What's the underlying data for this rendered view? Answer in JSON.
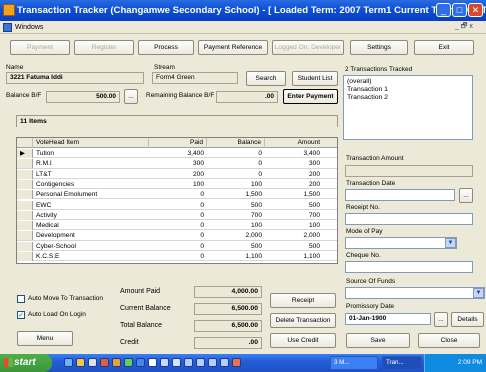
{
  "window": {
    "title": "Transaction Tracker (Changamwe Secondary School) - [ Loaded Term: 2007 Term1 Current Term:2007 Term1]",
    "menu_label": "Windows",
    "mdi_controls": "_ 🗗 x",
    "controls": {
      "minimize": "_",
      "maximize": "□",
      "close": "✕"
    }
  },
  "toolbar": {
    "payment": "Payment",
    "register": "Register",
    "process": "Process",
    "payment_reference": "Payment Reference",
    "logged_on": "Logged On: Developer",
    "settings": "Settings",
    "exit": "Exit"
  },
  "student": {
    "name_label": "Name",
    "name_value": "3221 Fatuma Iddi",
    "stream_label": "Stream",
    "stream_value": "Form4 Green",
    "search_button": "Search",
    "student_list_button": "Student List",
    "balance_bf_label": "Balance B/F",
    "balance_bf_value": "500.00",
    "ellipsis": "...",
    "remaining_label": "Remaining Balance B/F",
    "remaining_value": ".00",
    "enter_payment_button": "Enter Payment"
  },
  "items": {
    "count_label": "11 Items",
    "columns": [
      "VoteHead Item",
      "Paid",
      "Balance",
      "Amount"
    ],
    "rows": [
      {
        "item": "Tution",
        "paid": "3,400",
        "balance": "0",
        "amount": "3,400",
        "current": true
      },
      {
        "item": "R.M.I",
        "paid": "300",
        "balance": "0",
        "amount": "300"
      },
      {
        "item": "LT&T",
        "paid": "200",
        "balance": "0",
        "amount": "200"
      },
      {
        "item": "Contigencies",
        "paid": "100",
        "balance": "100",
        "amount": "200"
      },
      {
        "item": "Personal Emolument",
        "paid": "0",
        "balance": "1,500",
        "amount": "1,500"
      },
      {
        "item": "EWC",
        "paid": "0",
        "balance": "500",
        "amount": "500"
      },
      {
        "item": "Activity",
        "paid": "0",
        "balance": "700",
        "amount": "700"
      },
      {
        "item": "Medical",
        "paid": "0",
        "balance": "100",
        "amount": "100"
      },
      {
        "item": "Development",
        "paid": "0",
        "balance": "2,000",
        "amount": "2,000"
      },
      {
        "item": "Cyber-School",
        "paid": "0",
        "balance": "500",
        "amount": "500"
      },
      {
        "item": "K.C.S.E",
        "paid": "0",
        "balance": "1,100",
        "amount": "1,100"
      }
    ],
    "row_pointer": "▶"
  },
  "totals": {
    "amount_paid_label": "Amount Paid",
    "amount_paid_value": "4,000.00",
    "current_balance_label": "Current Balance",
    "current_balance_value": "6,500.00",
    "total_balance_label": "Total Balance",
    "total_balance_value": "6,500.00",
    "credit_label": "Credit",
    "credit_value": ".00"
  },
  "options": {
    "auto_move_label": "Auto Move To Transaction",
    "auto_move_checked": false,
    "auto_load_label": "Auto Load On Login",
    "auto_load_checked": true,
    "check_mark": "✓",
    "menu_button": "Menu"
  },
  "actions": {
    "receipt": "Receipt",
    "delete_transaction": "Delete Transaction",
    "use_credit": "Use Credit",
    "save": "Save",
    "close": "Close",
    "details": "Details",
    "date_picker": "..."
  },
  "transactions": {
    "header": "2 Transactions Tracked",
    "list": [
      "(overall)",
      "Transaction 1",
      "Transaction 2"
    ]
  },
  "form": {
    "transaction_amount_label": "Transaction Amount",
    "transaction_date_label": "Transaction Date",
    "receipt_no_label": "Receipt No.",
    "mode_of_pay_label": "Mode of Pay",
    "cheque_no_label": "Cheque No.",
    "source_of_funds_label": "Source Of Funds",
    "promissory_date_label": "Promissory Date",
    "promissory_date_value": "01-Jan-1900",
    "dropdown_arrow": "▼"
  },
  "taskbar": {
    "start_label": "start",
    "task1": "3 M...",
    "task2": "Tran...",
    "clock": "2:09 PM"
  },
  "colors": {
    "titlebar": "#0b4fd8",
    "face": "#ece9d8",
    "taskbar": "#245dd7",
    "start": "#3a9638"
  }
}
